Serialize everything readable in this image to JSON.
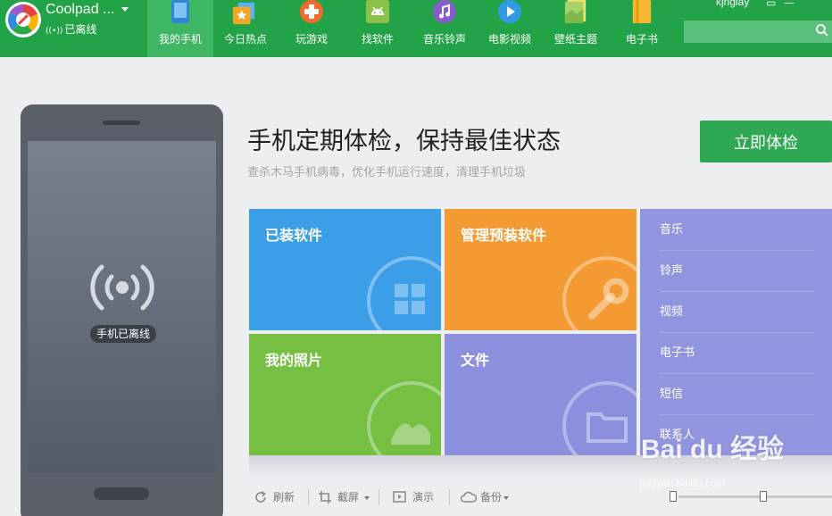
{
  "header": {
    "device_name": "Coolpad ...",
    "device_status": "已离线",
    "username": "kjngiay",
    "window_buttons": [
      "▭",
      "—"
    ],
    "search": {
      "placeholder": "",
      "value": ""
    },
    "nav": [
      {
        "label": "我的手机",
        "icon": "phone-icon",
        "active": true
      },
      {
        "label": "今日热点",
        "icon": "hot-news-icon",
        "active": false
      },
      {
        "label": "玩游戏",
        "icon": "gamepad-icon",
        "active": false
      },
      {
        "label": "找软件",
        "icon": "android-icon",
        "active": false
      },
      {
        "label": "音乐铃声",
        "icon": "music-icon",
        "active": false
      },
      {
        "label": "电影视频",
        "icon": "play-icon",
        "active": false
      },
      {
        "label": "壁纸主题",
        "icon": "wallpaper-icon",
        "active": false
      },
      {
        "label": "电子书",
        "icon": "ebook-icon",
        "active": false
      }
    ]
  },
  "phone": {
    "status_label": "手机已离线"
  },
  "main": {
    "headline": "手机定期体检，保持最佳状态",
    "subline": "查杀木马手机病毒，优化手机运行速度，清理手机垃圾",
    "check_button": "立即体检",
    "tiles": {
      "installed": "已装软件",
      "preinstalled": "管理预装软件",
      "photos": "我的照片",
      "files": "文件"
    },
    "media_items": [
      "音乐",
      "铃声",
      "视频",
      "电子书",
      "短信",
      "联系人"
    ]
  },
  "toolbar": {
    "refresh": "刷新",
    "screenshot": "截屏",
    "present": "演示",
    "backup": "备份"
  },
  "colors": {
    "header": "#23a347",
    "tile_installed": "#3d9ee8",
    "tile_preinstalled": "#f39a32",
    "tile_photos": "#76bf43",
    "tile_files": "#8b8fde",
    "media_panel": "#9195e0",
    "check_button": "#2fa854"
  },
  "watermark": {
    "brand": "Bai du 经验",
    "url": "jingyan.baidu.com"
  }
}
